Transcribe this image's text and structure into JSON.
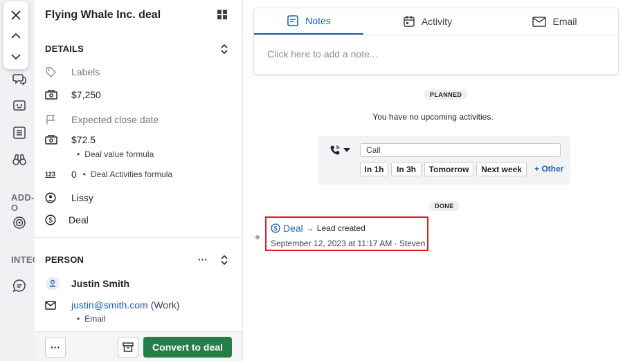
{
  "colors": {
    "accent": "#1a5fb4",
    "convert_button": "#257e4a",
    "highlight_border": "#e01b24"
  },
  "app_strip": {
    "items": [
      {
        "icon": "chat-bubbles-icon"
      },
      {
        "icon": "bot-icon"
      },
      {
        "icon": "list-icon"
      },
      {
        "icon": "binoculars-icon"
      },
      {
        "icon": "radar-icon"
      },
      {
        "icon": "comment-icon"
      }
    ],
    "section_labels": [
      "ADD-O",
      "INTEG"
    ]
  },
  "details": {
    "title": "Flying Whale Inc. deal",
    "details_header": "DETAILS",
    "fields": {
      "labels": "Labels",
      "value": "$7,250",
      "expected_close": "Expected close date",
      "formula_value": "$72.5",
      "formula_value_sub": "Deal value formula",
      "activities_count": "0",
      "activities_formula": "Deal Activities formula",
      "owner": "Lissy",
      "source": "Deal"
    },
    "person_header": "PERSON",
    "person_more": "···",
    "person": {
      "name": "Justin Smith",
      "email": "justin@smith.com",
      "email_type": "(Work)",
      "email_sub": "Email"
    },
    "bottom": {
      "more": "···",
      "convert": "Convert to deal"
    }
  },
  "main": {
    "tabs": [
      {
        "label": "Notes",
        "icon": "note-icon",
        "active": true
      },
      {
        "label": "Activity",
        "icon": "calendar-icon",
        "active": false
      },
      {
        "label": "Email",
        "icon": "envelope-icon",
        "active": false
      }
    ],
    "note_placeholder": "Click here to add a note...",
    "planned_badge": "PLANNED",
    "no_activities": "You have no upcoming activities.",
    "planner": {
      "activity_type_icon": "phone-icon",
      "activity_value": "Call",
      "quick_buttons": [
        "In 1h",
        "In 3h",
        "Tomorrow",
        "Next week"
      ],
      "other": "+ Other"
    },
    "done_badge": "DONE",
    "event": {
      "link": "Deal",
      "arrow": "→",
      "text": "Lead created",
      "meta": "September 12, 2023 at 11:17 AM · Steven"
    }
  }
}
